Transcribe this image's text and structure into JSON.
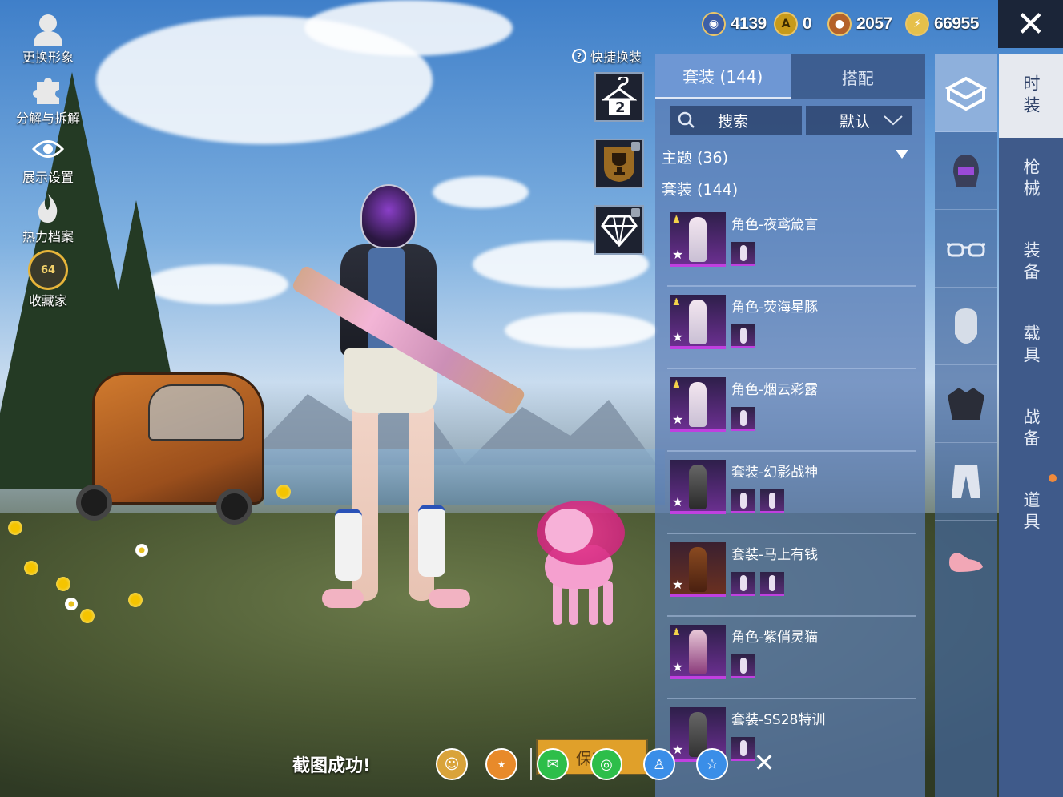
{
  "left_menu": [
    {
      "label": "更换形象",
      "icon": "avatar-icon"
    },
    {
      "label": "分解与拆解",
      "icon": "puzzle-icon"
    },
    {
      "label": "展示设置",
      "icon": "eye-icon"
    },
    {
      "label": "热力档案",
      "icon": "flame-icon"
    },
    {
      "label": "收藏家",
      "icon": "collector-badge-icon",
      "badge": "64"
    }
  ],
  "currencies": [
    {
      "value": "4139",
      "icon": "blue-coin-icon"
    },
    {
      "value": "0",
      "icon": "gold-token-icon"
    },
    {
      "value": "2057",
      "icon": "bronze-coin-icon"
    },
    {
      "value": "66955",
      "icon": "lightning-coin-icon"
    }
  ],
  "quick_swap": {
    "label": "快捷换装",
    "help": "?",
    "slot_number": "2"
  },
  "panel": {
    "tabs": [
      "套装 (144)",
      "搭配"
    ],
    "search_label": "搜索",
    "sort_label": "默认",
    "theme_header": "主题 (36)",
    "suits_header": "套装 (144)",
    "items": [
      {
        "name": "角色-夜鸢箴言",
        "subs": 1
      },
      {
        "name": "角色-荧海星豚",
        "subs": 1
      },
      {
        "name": "角色-烟云彩露",
        "subs": 1
      },
      {
        "name": "套装-幻影战神",
        "subs": 2
      },
      {
        "name": "套装-马上有钱",
        "subs": 2
      },
      {
        "name": "角色-紫俏灵猫",
        "subs": 1
      },
      {
        "name": "套装-SS28特训",
        "subs": 1
      }
    ]
  },
  "categories": [
    "outfit-box-icon",
    "helmet-icon",
    "glasses-icon",
    "mask-icon",
    "jacket-icon",
    "pants-icon",
    "shoes-icon"
  ],
  "vertical_tabs": [
    "时装",
    "枪械",
    "装备",
    "载具",
    "战备",
    "道具"
  ],
  "bottom_bar": {
    "toast": "截图成功!",
    "save_label": "保存",
    "share_icons": [
      "user-share-icon",
      "peace-elite-icon",
      "wechat-icon",
      "moments-icon",
      "qq-icon",
      "qzone-icon"
    ]
  },
  "colors": {
    "panel_bg": "#5c7db4",
    "active_tab": "#6e97d4",
    "rarity_purple": "#c040e0",
    "save_button": "#e0a02a"
  }
}
